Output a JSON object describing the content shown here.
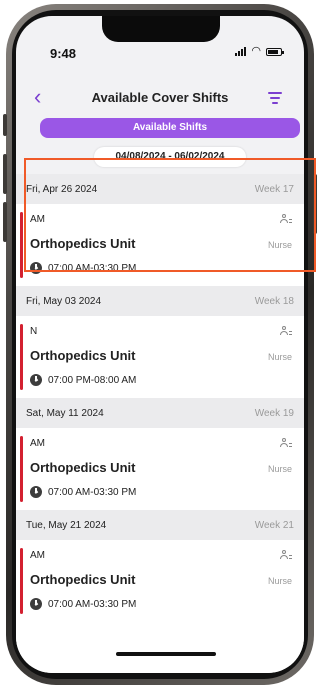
{
  "status_bar": {
    "time": "9:48"
  },
  "header": {
    "title": "Available Cover Shifts"
  },
  "tab_button": {
    "label": "Available Shifts"
  },
  "date_range": "04/08/2024 - 06/02/2024",
  "groups": [
    {
      "date": "Fri, Apr 26 2024",
      "week": "Week 17",
      "shift": {
        "code": "AM",
        "unit": "Orthopedics Unit",
        "role": "Nurse",
        "time": "07:00 AM-03:30 PM"
      }
    },
    {
      "date": "Fri, May 03 2024",
      "week": "Week 18",
      "shift": {
        "code": "N",
        "unit": "Orthopedics Unit",
        "role": "Nurse",
        "time": "07:00 PM-08:00 AM"
      }
    },
    {
      "date": "Sat, May 11 2024",
      "week": "Week 19",
      "shift": {
        "code": "AM",
        "unit": "Orthopedics Unit",
        "role": "Nurse",
        "time": "07:00 AM-03:30 PM"
      }
    },
    {
      "date": "Tue, May 21 2024",
      "week": "Week 21",
      "shift": {
        "code": "AM",
        "unit": "Orthopedics Unit",
        "role": "Nurse",
        "time": "07:00 AM-03:30 PM"
      }
    }
  ],
  "colors": {
    "accent": "#9a57e6",
    "header_icon": "#7b3fd0",
    "shift_bar": "#d32030",
    "highlight": "#f05a28"
  },
  "icons": {
    "back": "chevron-left-icon",
    "filter": "filter-icon",
    "person": "person-icon",
    "clock": "clock-icon"
  }
}
